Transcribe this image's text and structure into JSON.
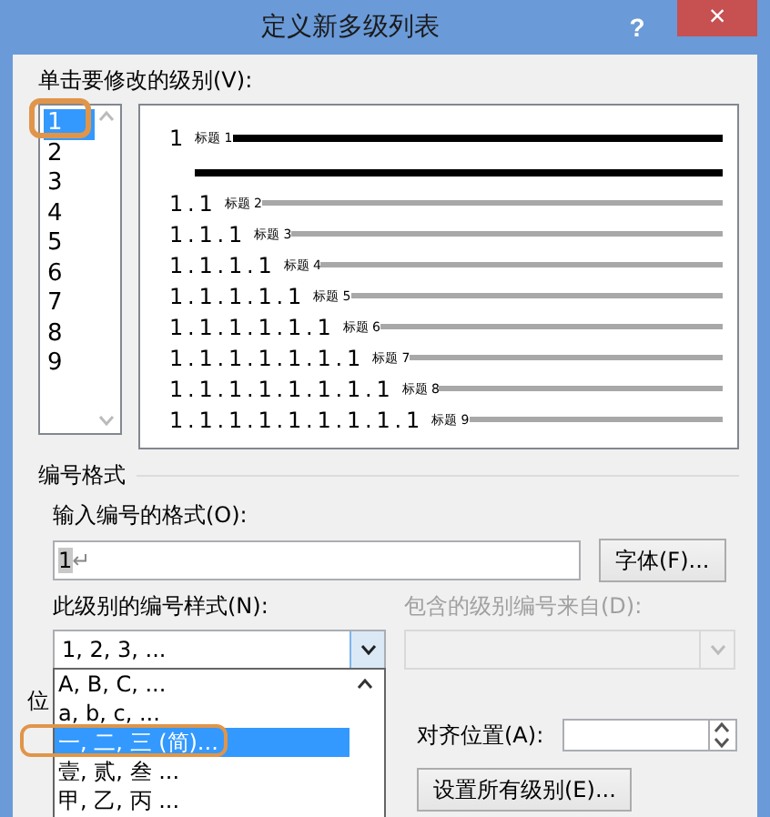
{
  "window": {
    "title": "定义新多级列表",
    "help": "?",
    "close": "×"
  },
  "level_list": {
    "label": "单击要修改的级别(V):",
    "items": [
      {
        "text": "1",
        "selected": true
      },
      {
        "text": "2",
        "selected": false
      },
      {
        "text": "3",
        "selected": false
      },
      {
        "text": "4",
        "selected": false
      },
      {
        "text": "5",
        "selected": false
      },
      {
        "text": "6",
        "selected": false
      },
      {
        "text": "7",
        "selected": false
      },
      {
        "text": "8",
        "selected": false
      },
      {
        "text": "9",
        "selected": false
      }
    ]
  },
  "preview": {
    "rows": [
      {
        "number": "1",
        "caption": "标题 1",
        "kind": "major"
      },
      {
        "number": "1.1",
        "caption": "标题 2",
        "kind": "minor"
      },
      {
        "number": "1.1.1",
        "caption": "标题 3",
        "kind": "minor"
      },
      {
        "number": "1.1.1.1",
        "caption": "标题 4",
        "kind": "minor"
      },
      {
        "number": "1.1.1.1.1",
        "caption": "标题 5",
        "kind": "minor"
      },
      {
        "number": "1.1.1.1.1.1",
        "caption": "标题 6",
        "kind": "minor"
      },
      {
        "number": "1.1.1.1.1.1.1",
        "caption": "标题 7",
        "kind": "minor"
      },
      {
        "number": "1.1.1.1.1.1.1.1",
        "caption": "标题 8",
        "kind": "minor"
      },
      {
        "number": "1.1.1.1.1.1.1.1.1",
        "caption": "标题 9",
        "kind": "minor"
      }
    ]
  },
  "number_format": {
    "title": "编号格式",
    "format_label": "输入编号的格式(O):",
    "format_value": "1↵",
    "font_button": "字体(F)...",
    "style_label": "此级别的编号样式(N):",
    "style_value": "1, 2, 3, ...",
    "include_label": "包含的级别编号来自(D):",
    "include_disabled": true,
    "style_options": [
      {
        "text": "A, B, C, ...",
        "selected": false
      },
      {
        "text": "a, b, c, ...",
        "selected": false
      },
      {
        "text": "一, 二, 三 (简)...",
        "selected": true
      },
      {
        "text": "壹, 贰, 叁 ...",
        "selected": false
      },
      {
        "text": "甲, 乙, 丙 ...",
        "selected": false
      }
    ],
    "position_label": "位",
    "align_label": "对齐位置(A):",
    "set_all_button": "设置所有级别(E)..."
  }
}
